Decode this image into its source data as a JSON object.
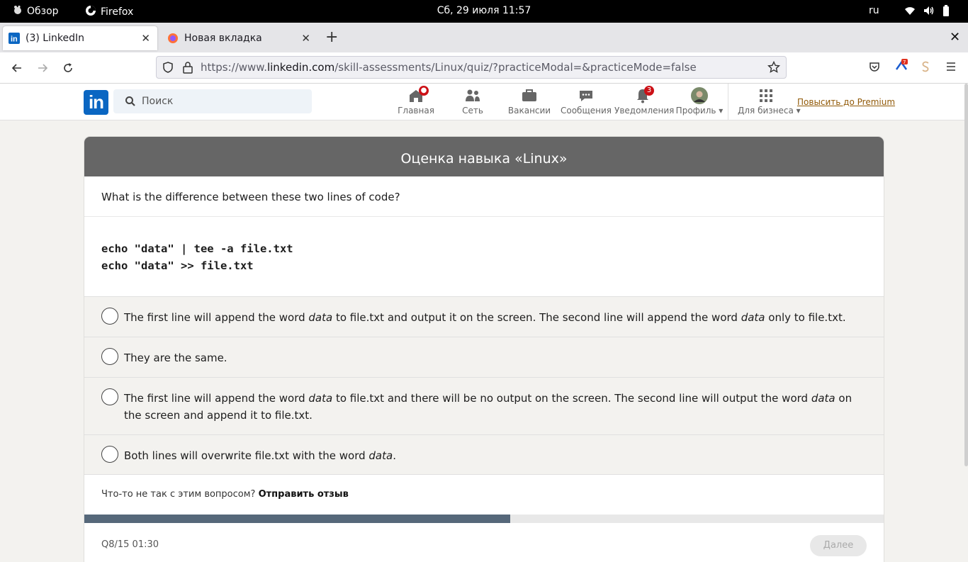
{
  "system": {
    "activities": "Обзор",
    "app_name": "Firefox",
    "clock": "Сб, 29 июля  11:57",
    "lang": "ru"
  },
  "browser": {
    "tabs": [
      {
        "title": "(3) LinkedIn",
        "active": true
      },
      {
        "title": "Новая вкладка",
        "active": false
      }
    ],
    "url_prefix": "https://www.",
    "url_domain": "linkedin.com",
    "url_path": "/skill-assessments/Linux/quiz/?practiceModal=&practiceMode=false"
  },
  "linkedin": {
    "logo": "in",
    "search_placeholder": "Поиск",
    "nav": [
      {
        "label": "Главная",
        "icon": "home-icon"
      },
      {
        "label": "Сеть",
        "icon": "network-icon"
      },
      {
        "label": "Вакансии",
        "icon": "jobs-icon"
      },
      {
        "label": "Сообщения",
        "icon": "messaging-icon"
      },
      {
        "label": "Уведомления",
        "icon": "bell-icon",
        "badge": "3"
      },
      {
        "label": "Профиль",
        "icon": "avatar"
      },
      {
        "label": "Для бизнеса",
        "icon": "grid-icon"
      }
    ],
    "premium": "Повысить до Premium"
  },
  "quiz": {
    "title": "Оценка навыка «Linux»",
    "question": "What is the difference between these two lines of code?",
    "code": "echo \"data\" | tee -a file.txt\necho \"data\" >> file.txt",
    "options": [
      {
        "pre": "The first line will append the word ",
        "em1": "data",
        "mid": " to file.txt and output it on the screen. The second line will append the word ",
        "em2": "data",
        "post": " only to file.txt."
      },
      {
        "pre": "They are the same.",
        "em1": "",
        "mid": "",
        "em2": "",
        "post": ""
      },
      {
        "pre": "The first line will append the word ",
        "em1": "data",
        "mid": " to file.txt and there will be no output on the screen. The second line will output the word ",
        "em2": "data",
        "post": " on the screen and append it to file.txt."
      },
      {
        "pre": "Both lines will overwrite file.txt with the word ",
        "em1": "data",
        "mid": ".",
        "em2": "",
        "post": ""
      }
    ],
    "feedback_text": "Что-то не так с этим вопросом? ",
    "feedback_link": "Отправить отзыв",
    "progress": 0.533,
    "counter": "Q8/15    01:30",
    "next_label": "Далее"
  }
}
